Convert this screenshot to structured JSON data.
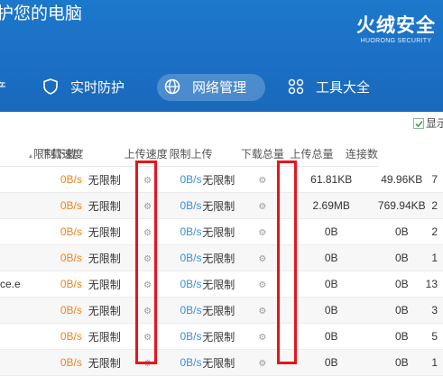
{
  "header": {
    "title": "护您的电脑",
    "brand_name": "火绒安全",
    "brand_sub": "HUORONG SECURITY"
  },
  "nav": {
    "partial": "产",
    "items": [
      {
        "label": "实时防护",
        "icon": "shield-icon"
      },
      {
        "label": "网络管理",
        "icon": "globe-icon",
        "active": true
      },
      {
        "label": "工具大全",
        "icon": "tools-icon"
      }
    ]
  },
  "toolbar": {
    "show_label": "显示"
  },
  "table": {
    "headers": {
      "sort": "▲",
      "dl_speed": "下载速度",
      "dl_limit": "限制下载",
      "ul_speed": "上传速度",
      "ul_limit": "限制上传",
      "dl_total": "下载总量",
      "ul_total": "上传总量",
      "conn": "连接数"
    },
    "rows": [
      {
        "name": "",
        "dl": "0B/s",
        "dl_limit": "无限制",
        "ul": "0B/s",
        "ul_limit": "无限制",
        "dl_total": "61.81KB",
        "ul_total": "49.96KB",
        "conn": "7"
      },
      {
        "name": "",
        "dl": "0B/s",
        "dl_limit": "无限制",
        "ul": "0B/s",
        "ul_limit": "无限制",
        "dl_total": "2.69MB",
        "ul_total": "769.94KB",
        "conn": "2"
      },
      {
        "name": "",
        "dl": "0B/s",
        "dl_limit": "无限制",
        "ul": "0B/s",
        "ul_limit": "无限制",
        "dl_total": "0B",
        "ul_total": "0B",
        "conn": "2"
      },
      {
        "name": "",
        "dl": "0B/s",
        "dl_limit": "无限制",
        "ul": "0B/s",
        "ul_limit": "无限制",
        "dl_total": "0B",
        "ul_total": "0B",
        "conn": "1"
      },
      {
        "name": "ce.e",
        "dl": "0B/s",
        "dl_limit": "无限制",
        "ul": "0B/s",
        "ul_limit": "无限制",
        "dl_total": "0B",
        "ul_total": "0B",
        "conn": "13"
      },
      {
        "name": "",
        "dl": "0B/s",
        "dl_limit": "无限制",
        "ul": "0B/s",
        "ul_limit": "无限制",
        "dl_total": "0B",
        "ul_total": "0B",
        "conn": "3"
      },
      {
        "name": "",
        "dl": "0B/s",
        "dl_limit": "无限制",
        "ul": "0B/s",
        "ul_limit": "无限制",
        "dl_total": "0B",
        "ul_total": "0B",
        "conn": "5"
      },
      {
        "name": "",
        "dl": "0B/s",
        "dl_limit": "无限制",
        "ul": "0B/s",
        "ul_limit": "无限制",
        "dl_total": "0B",
        "ul_total": "0B",
        "conn": "1"
      }
    ]
  },
  "colors": {
    "header_blue": "#1b6fc4",
    "download_orange": "#f0831e",
    "upload_blue": "#3c8fd8",
    "highlight_red": "#e8141b"
  }
}
